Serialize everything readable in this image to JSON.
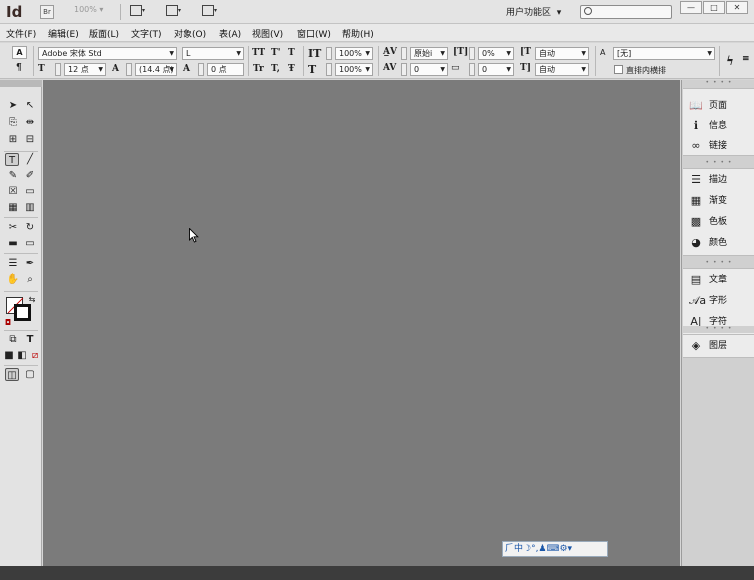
{
  "titlebar": {
    "app_logo": "Id",
    "bridge_label": "Br",
    "zoom": "100%",
    "zoom_arrow": "▾",
    "workspace": "用户功能区",
    "workspace_arrow": "▾",
    "minimize": "—",
    "maximize": "□",
    "close": "✕"
  },
  "menu": {
    "items": [
      "文件(F)",
      "编辑(E)",
      "版面(L)",
      "文字(T)",
      "对象(O)",
      "表(A)",
      "视图(V)",
      "窗口(W)",
      "帮助(H)"
    ]
  },
  "control": {
    "font_family": "Adobe 宋体 Std",
    "font_style": "L",
    "font_size": "12 点",
    "leading": "(14.4 点)",
    "kerning": "原始设定",
    "kerning_short": "原始i",
    "tracking": "0",
    "vertical_scale": "100%",
    "horizontal_scale": "100%",
    "baseline_shift": "0 点",
    "tsume": "0%",
    "aki_before": "自动",
    "aki_after": "自动",
    "char_rotate": "0",
    "grid_chars": "0",
    "char_style": "[无]",
    "checkbox_label": "直排内横排",
    "glyph_tt": "TT",
    "glyph_tsup": "T'",
    "glyph_t": "T",
    "glyph_tr": "Tr",
    "glyph_tsub": "T,",
    "glyph_tstrike": "Ŧ",
    "glyph_a": "A",
    "glyph_para": "¶",
    "glyph_lightning": "ϟ",
    "glyph_more": "≡"
  },
  "tools": {
    "grip": "• • •",
    "icons": [
      "➤",
      "↖",
      "⎘",
      "⇹",
      "⊞",
      "⊟",
      "T",
      "╱",
      "✎",
      "✐",
      "☒",
      "▭",
      "▦",
      "▥",
      "✂",
      "↻",
      "▬",
      "▭",
      "☰",
      "✒",
      "✋",
      "⌕",
      "⧉",
      "T",
      "■",
      "◧",
      "⧄",
      "◫",
      "▢"
    ],
    "swatch_swap": "⇆",
    "swatch_default": "◘"
  },
  "panels": {
    "grip": "• • • •",
    "group1": [
      {
        "icon": "📖",
        "label": "页面"
      },
      {
        "icon": "ℹ",
        "label": "信息"
      },
      {
        "icon": "∞",
        "label": "链接"
      }
    ],
    "group2": [
      {
        "icon": "☰",
        "label": "描边"
      },
      {
        "icon": "▦",
        "label": "渐变"
      },
      {
        "icon": "▩",
        "label": "色板"
      },
      {
        "icon": "◕",
        "label": "颜色"
      }
    ],
    "group3": [
      {
        "icon": "▤",
        "label": "文章"
      },
      {
        "icon": "𝒜a",
        "label": "字形"
      },
      {
        "icon": "A|",
        "label": "字符"
      }
    ],
    "group4": [
      {
        "icon": "◈",
        "label": "图层"
      }
    ]
  },
  "ime": {
    "text": "⺁中☽°,♟⌨⚙▾"
  },
  "colors": {
    "canvas": "#7b7b7b",
    "ui_light": "#e3e3e3",
    "statusbar": "#3c3c3c",
    "logo": "#3b2a26"
  }
}
